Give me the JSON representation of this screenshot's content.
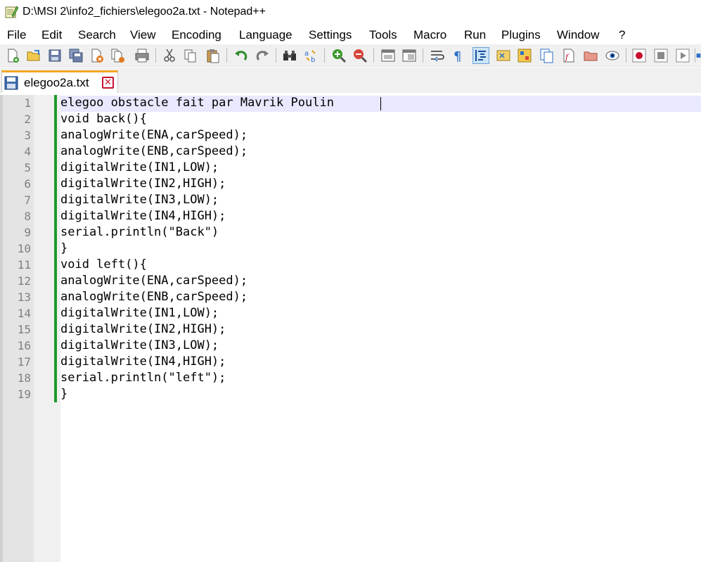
{
  "window": {
    "title": "D:\\MSI 2\\info2_fichiers\\elegoo2a.txt - Notepad++"
  },
  "menu": [
    "File",
    "Edit",
    "Search",
    "View",
    "Encoding",
    "Language",
    "Settings",
    "Tools",
    "Macro",
    "Run",
    "Plugins",
    "Window",
    "?"
  ],
  "toolbar": {
    "icons": [
      "new-file-icon",
      "open-file-icon",
      "save-icon",
      "save-all-icon",
      "close-icon",
      "close-all-icon",
      "print-icon",
      "cut-icon",
      "copy-icon",
      "paste-icon",
      "undo-icon",
      "redo-icon",
      "find-icon",
      "replace-icon",
      "zoom-in-icon",
      "zoom-out-icon",
      "sync-vertical-icon",
      "sync-horizontal-icon",
      "word-wrap-icon",
      "show-all-chars-icon",
      "indent-guide-icon",
      "user-language-icon",
      "document-map-icon",
      "document-list-icon",
      "function-list-icon",
      "folder-workspace-icon",
      "monitoring-icon",
      "record-macro-icon",
      "stop-record-icon",
      "play-macro-icon"
    ]
  },
  "tab": {
    "label": "elegoo2a.txt"
  },
  "editor": {
    "lines": [
      {
        "n": "1",
        "text": "elegoo obstacle fait par Mavrik Poulin"
      },
      {
        "n": "2",
        "text": "void back(){"
      },
      {
        "n": "3",
        "text": "analogWrite(ENA,carSpeed);"
      },
      {
        "n": "4",
        "text": "analogWrite(ENB,carSpeed);"
      },
      {
        "n": "5",
        "text": "digitalWrite(IN1,LOW);"
      },
      {
        "n": "6",
        "text": "digitalWrite(IN2,HIGH);"
      },
      {
        "n": "7",
        "text": "digitalWrite(IN3,LOW);"
      },
      {
        "n": "8",
        "text": "digitalWrite(IN4,HIGH);"
      },
      {
        "n": "9",
        "text": "serial.println(\"Back\")"
      },
      {
        "n": "10",
        "text": "}"
      },
      {
        "n": "11",
        "text": "void left(){"
      },
      {
        "n": "12",
        "text": "analogWrite(ENA,carSpeed);"
      },
      {
        "n": "13",
        "text": "analogWrite(ENB,carSpeed);"
      },
      {
        "n": "14",
        "text": "digitalWrite(IN1,LOW);"
      },
      {
        "n": "15",
        "text": "digitalWrite(IN2,HIGH);"
      },
      {
        "n": "16",
        "text": "digitalWrite(IN3,LOW);"
      },
      {
        "n": "17",
        "text": "digitalWrite(IN4,HIGH);"
      },
      {
        "n": "18",
        "text": "serial.println(\"left\");"
      },
      {
        "n": "19",
        "text": "}"
      }
    ]
  },
  "colors": {
    "change_bar": "#1f9a2e",
    "caret_line": "#e8e8ff",
    "tab_accent": "#f5a623",
    "close_red": "#c8102e"
  }
}
